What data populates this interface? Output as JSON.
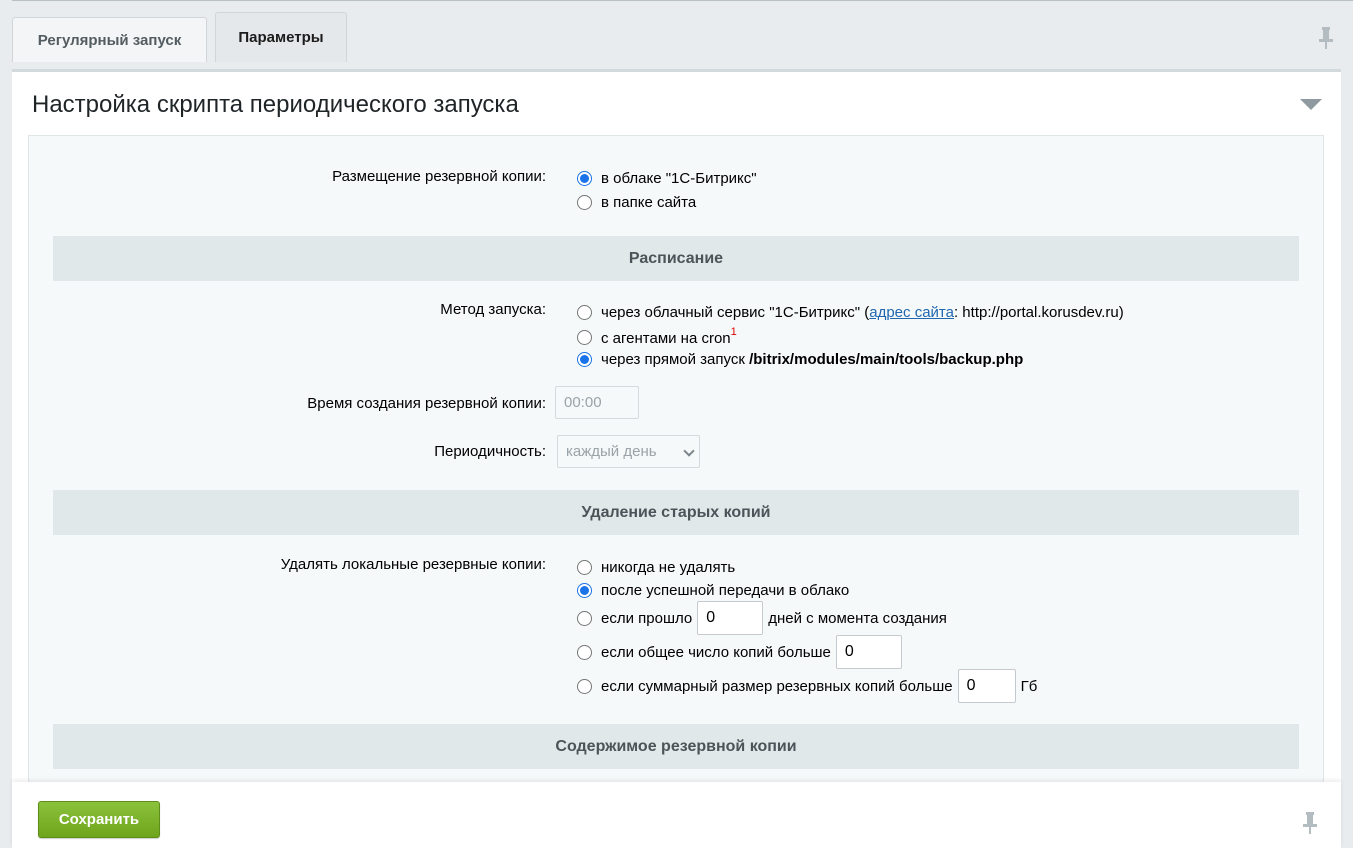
{
  "tabs": [
    "Регулярный запуск",
    "Параметры"
  ],
  "panel": {
    "title": "Настройка скрипта периодического запуска"
  },
  "placement": {
    "label": "Размещение резервной копии:",
    "options": [
      "в облаке \"1С-Битрикс\"",
      "в папке сайта"
    ],
    "selected": 0
  },
  "schedule": {
    "section_title": "Расписание",
    "method_label": "Метод запуска:",
    "method_option1_text": "через облачный сервис \"1С-Битрикс\" (",
    "method_option1_link": "адрес сайта",
    "method_option1_tail": ": http://portal.korusdev.ru)",
    "method_option2_text": "с агентами на cron",
    "method_option2_footnote": "1",
    "method_option3_text": "через прямой запуск ",
    "method_option3_path": "/bitrix/modules/main/tools/backup.php",
    "method_selected": 2,
    "time_label": "Время создания резервной копии:",
    "time_value": "00:00",
    "period_label": "Периодичность:",
    "period_value": "каждый день"
  },
  "cleanup": {
    "section_title": "Удаление старых копий",
    "label": "Удалять локальные резервные копии:",
    "opt_never": "никогда не удалять",
    "opt_after_transfer": "после успешной передачи в облако",
    "opt_days_prefix": "если прошло",
    "opt_days_value": "0",
    "opt_days_suffix": "дней с момента создания",
    "opt_count_prefix": "если общее число копий больше",
    "opt_count_value": "0",
    "opt_size_prefix": "если суммарный размер резервных копий больше",
    "opt_size_value": "0",
    "opt_size_unit": "Гб",
    "selected": 1
  },
  "contents": {
    "section_title": "Содержимое резервной копии"
  },
  "footer": {
    "save_label": "Сохранить"
  }
}
